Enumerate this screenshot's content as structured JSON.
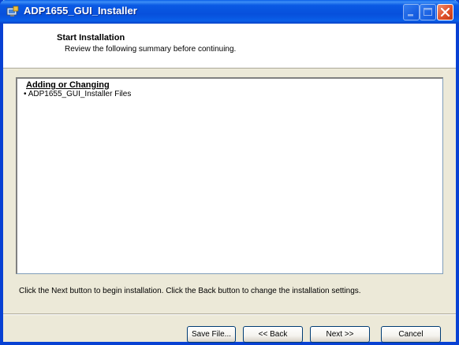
{
  "window": {
    "title": "ADP1655_GUI_Installer",
    "icon": "installer-icon"
  },
  "header": {
    "title": "Start Installation",
    "subtitle": "Review the following summary before continuing."
  },
  "summary": {
    "heading": "Adding or Changing",
    "items": [
      "• ADP1655_GUI_Installer Files"
    ]
  },
  "instruction": "Click the Next button to begin installation.  Click the Back button to change the installation settings.",
  "buttons": {
    "save_file": "Save File...",
    "back": "<< Back",
    "next": "Next >>",
    "cancel": "Cancel"
  },
  "colors": {
    "titlebar": "#0a5ae4",
    "dialog_bg": "#ece9d8",
    "close_button": "#e0502a"
  }
}
